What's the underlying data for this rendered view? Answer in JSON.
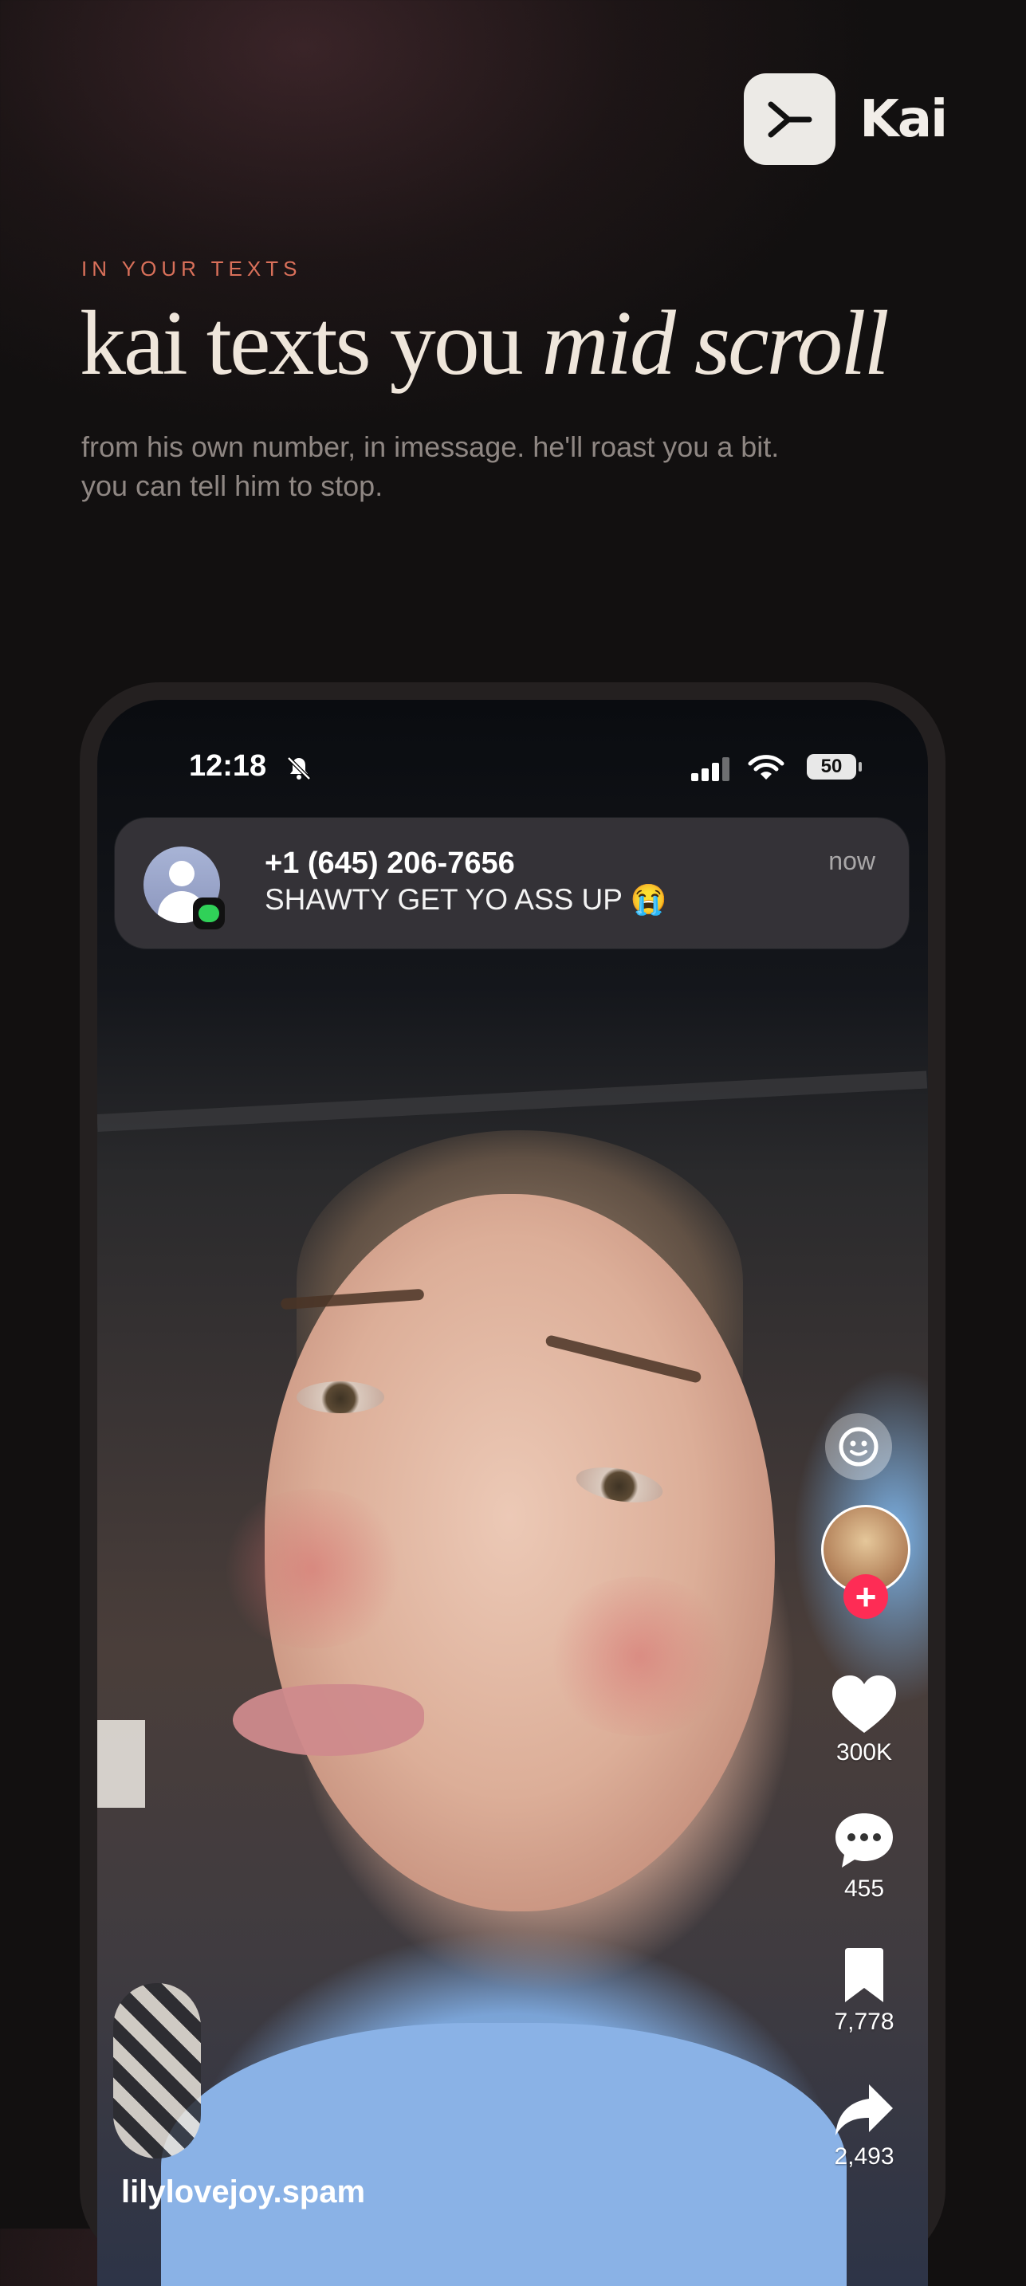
{
  "brand": {
    "name": "Kai",
    "logo_icon": "prompt-chevron-icon"
  },
  "hero": {
    "eyebrow": "IN YOUR TEXTS",
    "headline_plain": "kai texts you ",
    "headline_italic": "mid scroll",
    "subtext": "from his own number, in imessage. he'll roast you a bit. you can tell him to stop."
  },
  "phone": {
    "status": {
      "time": "12:18",
      "battery": "50",
      "icons": [
        "bell-slash-icon",
        "cellular-signal-icon",
        "wifi-icon",
        "battery-icon"
      ]
    },
    "notification": {
      "sender": "+1 (645) 206-7656",
      "message": "SHAWTY GET YO ASS UP 😭",
      "time": "now",
      "app_icon": "imessage-icon"
    },
    "video": {
      "username": "lilylovejoy.spam",
      "likes": "300K",
      "comments": "455",
      "saves": "7,778",
      "shares": "2,493",
      "follow_label": "+"
    }
  },
  "colors": {
    "accent": "#d9705a",
    "headline": "#efe6db",
    "follow_red": "#fe2c55"
  }
}
